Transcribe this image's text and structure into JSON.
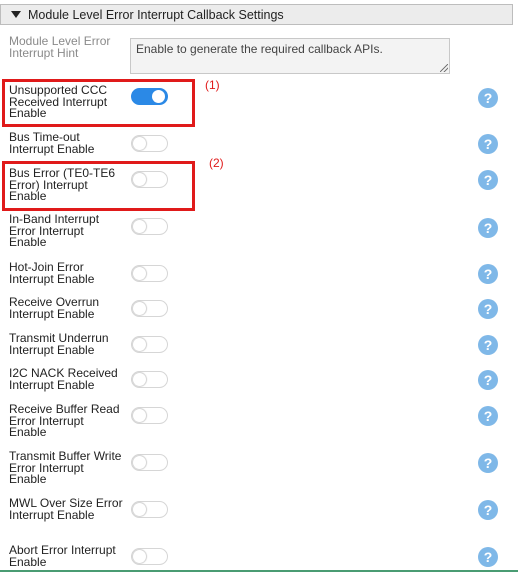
{
  "section": {
    "title": "Module Level Error Interrupt Callback Settings"
  },
  "hint": {
    "label": "Module Level Error Interrupt Hint",
    "value": "Enable to generate the required callback APIs."
  },
  "rows": [
    {
      "label": "Unsupported CCC Received Interrupt Enable",
      "enabled": true
    },
    {
      "label": "Bus Time-out Interrupt Enable",
      "enabled": false
    },
    {
      "label": "Bus Error (TE0-TE6 Error) Interrupt Enable",
      "enabled": false
    },
    {
      "label": "In-Band Interrupt Error Interrupt Enable",
      "enabled": false
    },
    {
      "label": "Hot-Join Error Interrupt Enable",
      "enabled": false
    },
    {
      "label": "Receive Overrun Interrupt Enable",
      "enabled": false
    },
    {
      "label": "Transmit Underrun Interrupt Enable",
      "enabled": false
    },
    {
      "label": "I2C NACK Received Interrupt Enable",
      "enabled": false
    },
    {
      "label": "Receive Buffer Read Error Interrupt Enable",
      "enabled": false
    },
    {
      "label": "Transmit Buffer Write Error Interrupt Enable",
      "enabled": false
    },
    {
      "label": "MWL Over Size Error Interrupt Enable",
      "enabled": false
    },
    {
      "label": "Abort Error Interrupt Enable",
      "enabled": false
    }
  ],
  "help_glyph": "?",
  "annotations": {
    "first": "(1)",
    "second": "(2)"
  },
  "colors": {
    "toggle_on": "#2b89e6",
    "help": "#7fb8e8",
    "highlight": "#e01a1a"
  }
}
